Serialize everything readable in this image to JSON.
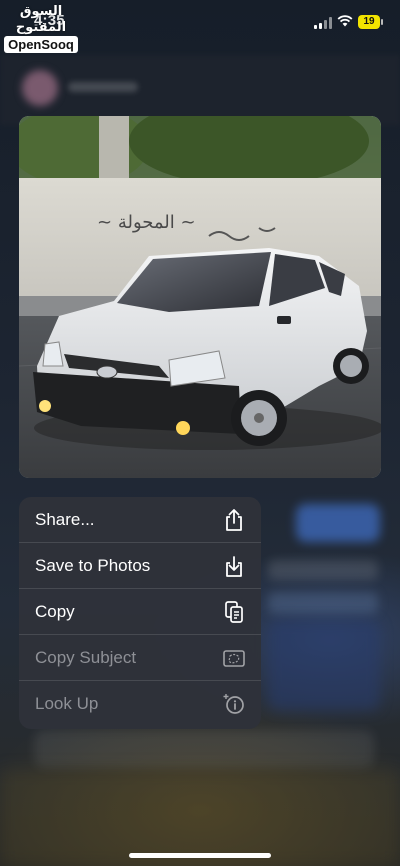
{
  "status_bar": {
    "time": "4:35",
    "battery_level": "19"
  },
  "watermark": {
    "arabic": "السوق المفتوح",
    "english": "OpenSooq"
  },
  "photo": {
    "wall_graffiti": "المحولة",
    "subject": "white Toyota sedan"
  },
  "context_menu": {
    "items": [
      {
        "label": "Share...",
        "icon": "share-icon",
        "enabled": true
      },
      {
        "label": "Save to Photos",
        "icon": "save-to-photos-icon",
        "enabled": true
      },
      {
        "label": "Copy",
        "icon": "copy-icon",
        "enabled": true
      },
      {
        "label": "Copy Subject",
        "icon": "copy-subject-icon",
        "enabled": false
      },
      {
        "label": "Look Up",
        "icon": "look-up-icon",
        "enabled": false
      }
    ]
  },
  "colors": {
    "menu_background": "#2e323a",
    "battery_fill": "#f2e400",
    "disabled_text": "#8e9096"
  }
}
